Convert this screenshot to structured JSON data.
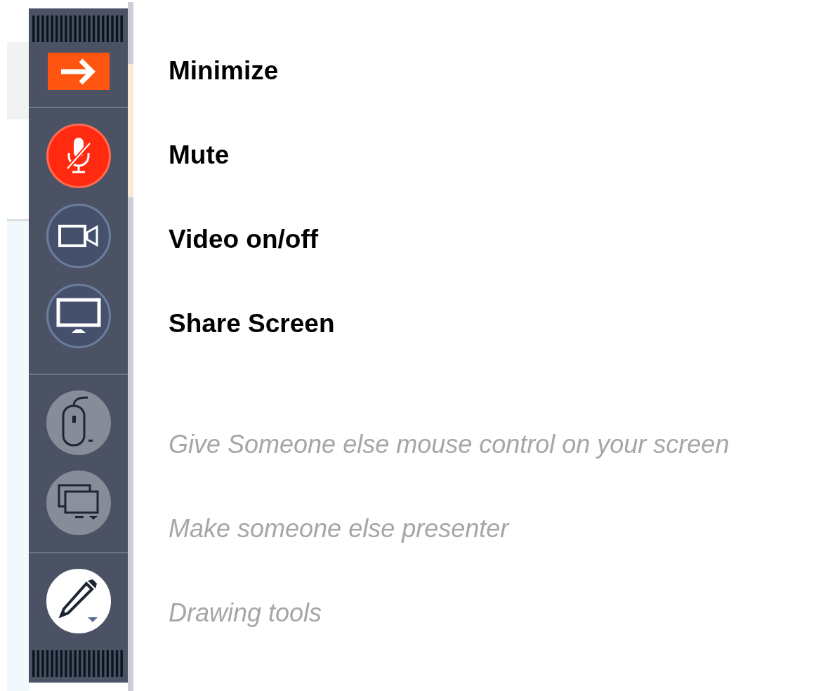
{
  "toolbar": {
    "groups": [
      [
        {
          "kind": "minimize"
        }
      ],
      [
        {
          "kind": "microphone",
          "muted": true,
          "disabled": false
        },
        {
          "kind": "camera",
          "muted": false,
          "disabled": false
        },
        {
          "kind": "screen",
          "muted": false,
          "disabled": false
        }
      ],
      [
        {
          "kind": "mouse",
          "disabled": true
        },
        {
          "kind": "presenter",
          "disabled": true
        }
      ],
      [
        {
          "kind": "pencil",
          "disabled": false
        }
      ]
    ]
  },
  "labels": [
    {
      "text": "Minimize",
      "disabled": false
    },
    {
      "text": "Mute",
      "disabled": false
    },
    {
      "text": "Video on/off",
      "disabled": false
    },
    {
      "text": "Share Screen",
      "disabled": false
    },
    {
      "text": "Give Someone else mouse control on your screen",
      "disabled": true
    },
    {
      "text": "Make someone else presenter",
      "disabled": true
    },
    {
      "text": "Drawing tools",
      "disabled": true
    }
  ]
}
